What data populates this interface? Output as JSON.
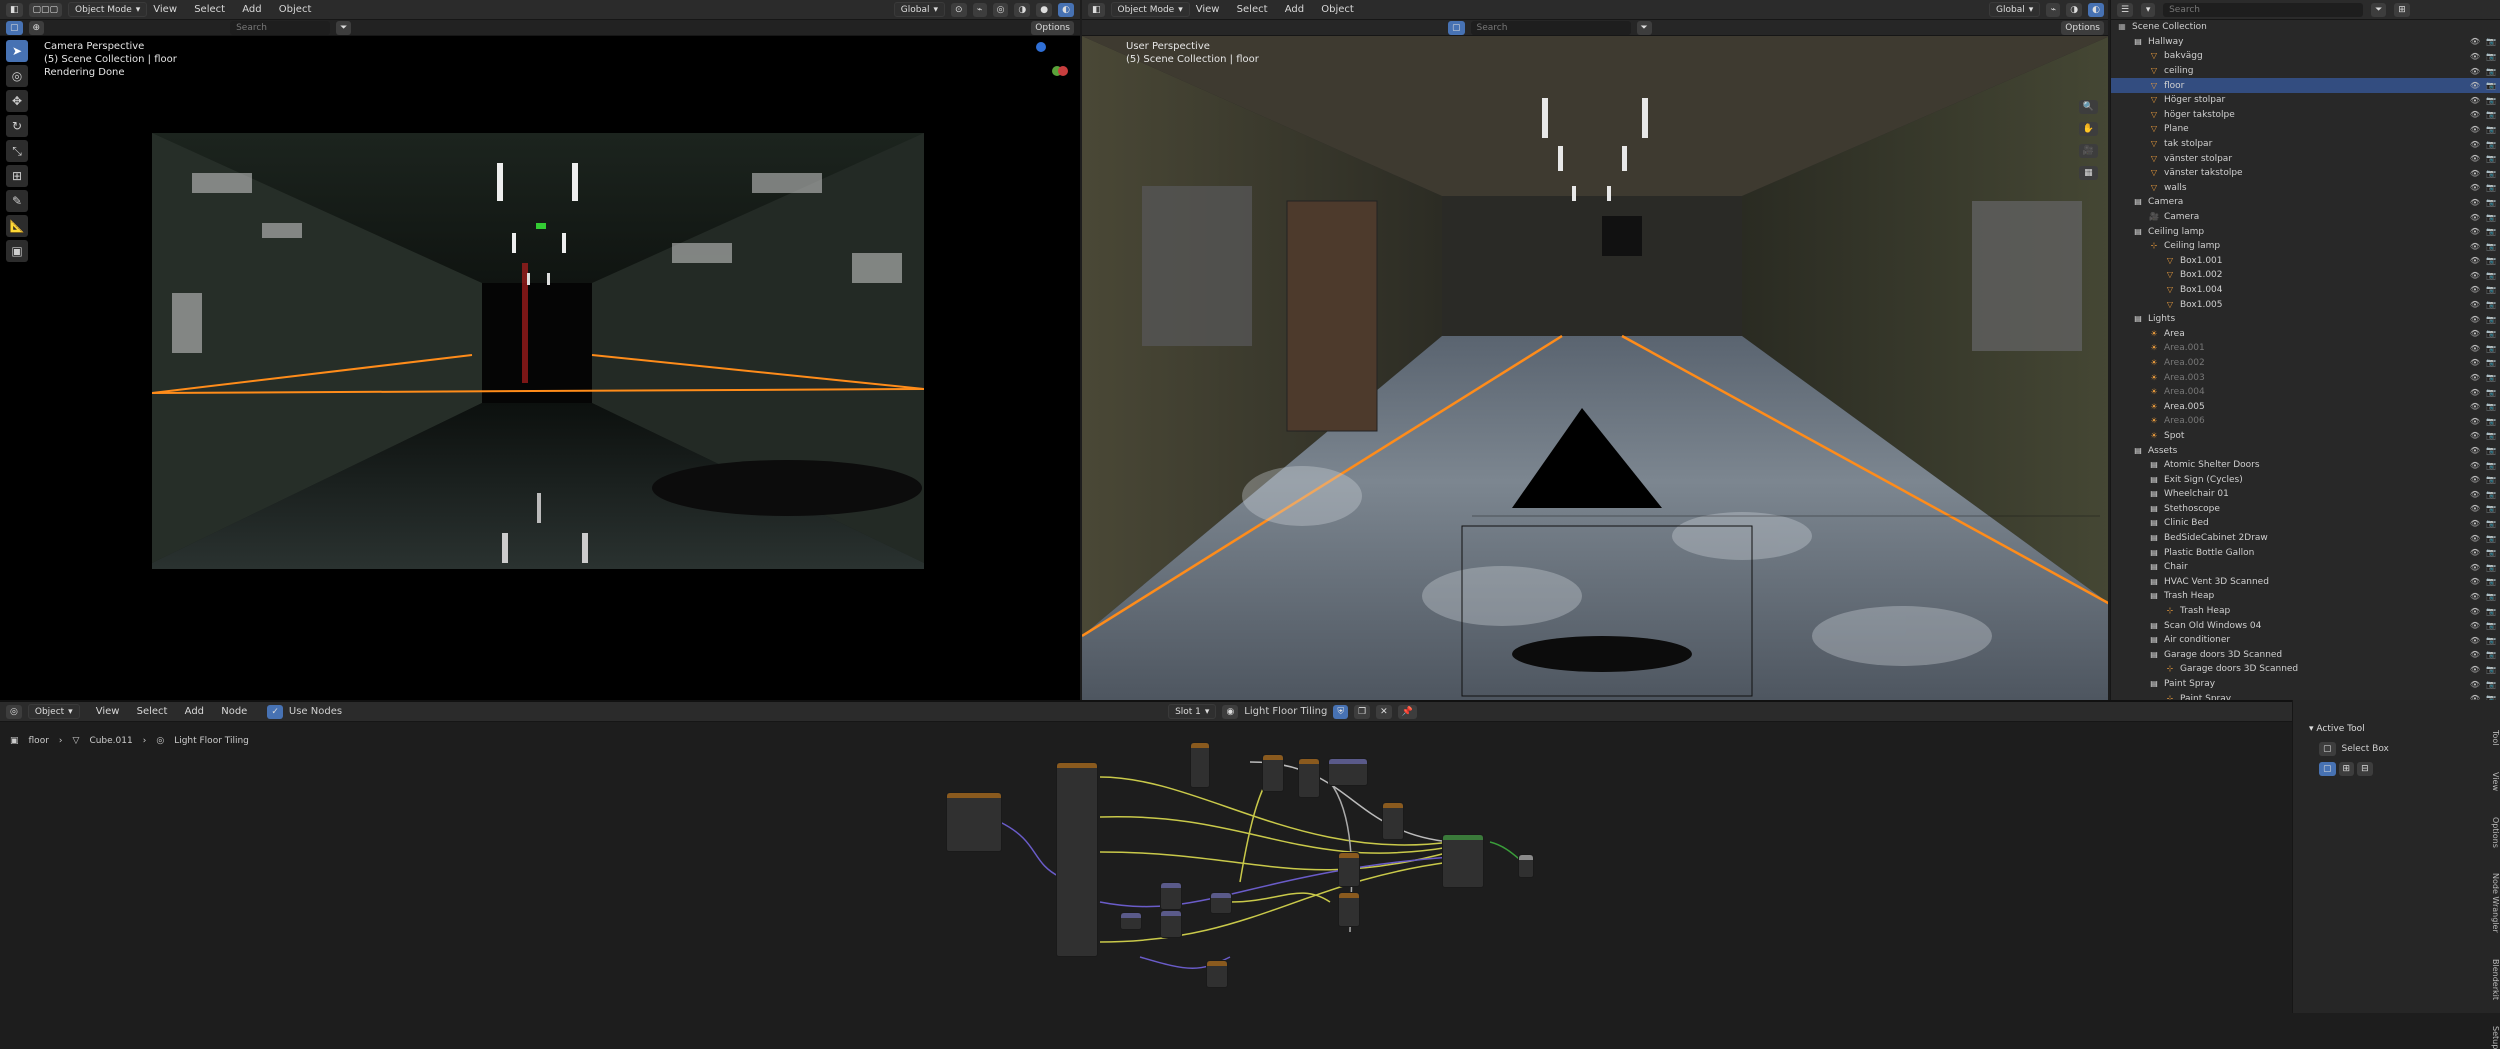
{
  "left_view": {
    "mode": "Object Mode",
    "menus": [
      "View",
      "Select",
      "Add",
      "Object"
    ],
    "orientation": "Global",
    "search_placeholder": "Search",
    "options_label": "Options",
    "overlay": [
      "Camera Perspective",
      "(5) Scene Collection | floor",
      "Rendering Done"
    ]
  },
  "right_view": {
    "mode": "Object Mode",
    "menus": [
      "View",
      "Select",
      "Add",
      "Object"
    ],
    "orientation": "Global",
    "search_placeholder": "Search",
    "options_label": "Options",
    "overlay": [
      "User Perspective",
      "(5) Scene Collection | floor"
    ]
  },
  "outliner": {
    "search_placeholder": "Search",
    "root": "Scene Collection",
    "rows": [
      {
        "label": "Hallway",
        "depth": 1,
        "type": "collection"
      },
      {
        "label": "bakvägg",
        "depth": 2,
        "type": "mesh"
      },
      {
        "label": "ceiling",
        "depth": 2,
        "type": "mesh"
      },
      {
        "label": "floor",
        "depth": 2,
        "type": "mesh",
        "selected": true
      },
      {
        "label": "Höger stolpar",
        "depth": 2,
        "type": "mesh"
      },
      {
        "label": "höger takstolpe",
        "depth": 2,
        "type": "mesh"
      },
      {
        "label": "Plane",
        "depth": 2,
        "type": "mesh"
      },
      {
        "label": "tak stolpar",
        "depth": 2,
        "type": "mesh"
      },
      {
        "label": "vänster stolpar",
        "depth": 2,
        "type": "mesh"
      },
      {
        "label": "vänster takstolpe",
        "depth": 2,
        "type": "mesh"
      },
      {
        "label": "walls",
        "depth": 2,
        "type": "mesh"
      },
      {
        "label": "Camera",
        "depth": 1,
        "type": "collection"
      },
      {
        "label": "Camera",
        "depth": 2,
        "type": "camera"
      },
      {
        "label": "Ceiling lamp",
        "depth": 1,
        "type": "collection"
      },
      {
        "label": "Ceiling lamp",
        "depth": 2,
        "type": "empty"
      },
      {
        "label": "Box1.001",
        "depth": 3,
        "type": "mesh"
      },
      {
        "label": "Box1.002",
        "depth": 3,
        "type": "mesh"
      },
      {
        "label": "Box1.004",
        "depth": 3,
        "type": "mesh"
      },
      {
        "label": "Box1.005",
        "depth": 3,
        "type": "mesh"
      },
      {
        "label": "Lights",
        "depth": 1,
        "type": "collection"
      },
      {
        "label": "Area",
        "depth": 2,
        "type": "light"
      },
      {
        "label": "Area.001",
        "depth": 2,
        "type": "light",
        "dim": true
      },
      {
        "label": "Area.002",
        "depth": 2,
        "type": "light",
        "dim": true
      },
      {
        "label": "Area.003",
        "depth": 2,
        "type": "light",
        "dim": true
      },
      {
        "label": "Area.004",
        "depth": 2,
        "type": "light",
        "dim": true
      },
      {
        "label": "Area.005",
        "depth": 2,
        "type": "light"
      },
      {
        "label": "Area.006",
        "depth": 2,
        "type": "light",
        "dim": true
      },
      {
        "label": "Spot",
        "depth": 2,
        "type": "light"
      },
      {
        "label": "Assets",
        "depth": 1,
        "type": "collection"
      },
      {
        "label": "Atomic Shelter Doors",
        "depth": 2,
        "type": "collection"
      },
      {
        "label": "Exit Sign (Cycles)",
        "depth": 2,
        "type": "collection"
      },
      {
        "label": "Wheelchair 01",
        "depth": 2,
        "type": "collection"
      },
      {
        "label": "Stethoscope",
        "depth": 2,
        "type": "collection"
      },
      {
        "label": "Clinic Bed",
        "depth": 2,
        "type": "collection"
      },
      {
        "label": "BedSideCabinet 2Draw",
        "depth": 2,
        "type": "collection"
      },
      {
        "label": "Plastic Bottle Gallon",
        "depth": 2,
        "type": "collection"
      },
      {
        "label": "Chair",
        "depth": 2,
        "type": "collection"
      },
      {
        "label": "HVAC Vent 3D Scanned",
        "depth": 2,
        "type": "collection"
      },
      {
        "label": "Trash Heap",
        "depth": 2,
        "type": "collection"
      },
      {
        "label": "Trash Heap",
        "depth": 3,
        "type": "empty"
      },
      {
        "label": "Scan Old Windows 04",
        "depth": 2,
        "type": "collection"
      },
      {
        "label": "Air conditioner",
        "depth": 2,
        "type": "collection"
      },
      {
        "label": "Garage doors 3D Scanned",
        "depth": 2,
        "type": "collection"
      },
      {
        "label": "Garage doors 3D Scanned",
        "depth": 3,
        "type": "empty"
      },
      {
        "label": "Paint Spray",
        "depth": 2,
        "type": "collection"
      },
      {
        "label": "Paint Spray",
        "depth": 3,
        "type": "empty"
      }
    ]
  },
  "node_editor": {
    "editor_type": "Object",
    "menus": [
      "View",
      "Select",
      "Add",
      "Node"
    ],
    "use_nodes_label": "Use Nodes",
    "slot": "Slot 1",
    "material": "Light Floor Tiling",
    "breadcrumb": [
      "floor",
      "Cube.011",
      "Light Floor Tiling"
    ]
  },
  "sidebar": {
    "panel_title": "Active Tool",
    "tool_name": "Select Box",
    "tabs": [
      "Tool",
      "View",
      "Options",
      "Node Wrangler",
      "Blenderkit",
      "Setup"
    ]
  },
  "colors": {
    "accent": "#4772b3",
    "select_outline": "#ff8c1a",
    "header": "#2b2b2b"
  }
}
